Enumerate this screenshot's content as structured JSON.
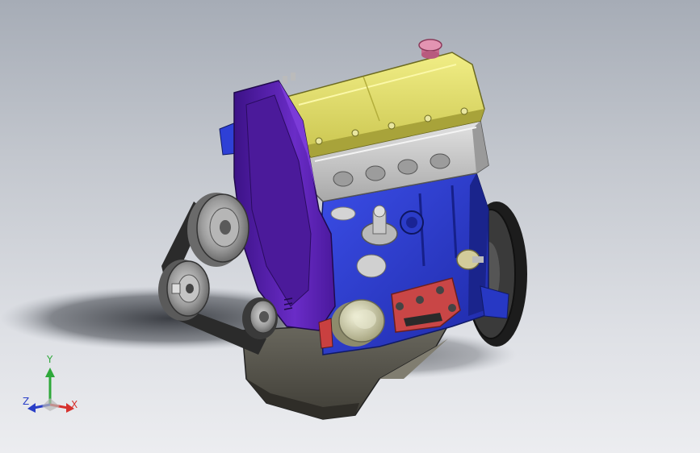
{
  "viewport": {
    "background_top": "#a6acb6",
    "background_bottom": "#ecedf0"
  },
  "model": {
    "colors": {
      "valve_cover": "#e4e06a",
      "timing_cover": "#5a1fb0",
      "engine_block": "#2e3fd6",
      "cylinder_head": "#c8c8c8",
      "oil_pan": "#55534a",
      "flywheel": "#2a2a2a",
      "oil_cap": "#d97fa0",
      "oil_filter": "#dcdcc0",
      "pulleys": "#9a9a9a",
      "accent_parts": "#d84848"
    }
  },
  "triad": {
    "x_label": "X",
    "y_label": "Y",
    "z_label": "Z",
    "x_color": "#d6322e",
    "y_color": "#2ea83a",
    "z_color": "#2a3fc7",
    "icon": "coordinate-triad-icon"
  }
}
